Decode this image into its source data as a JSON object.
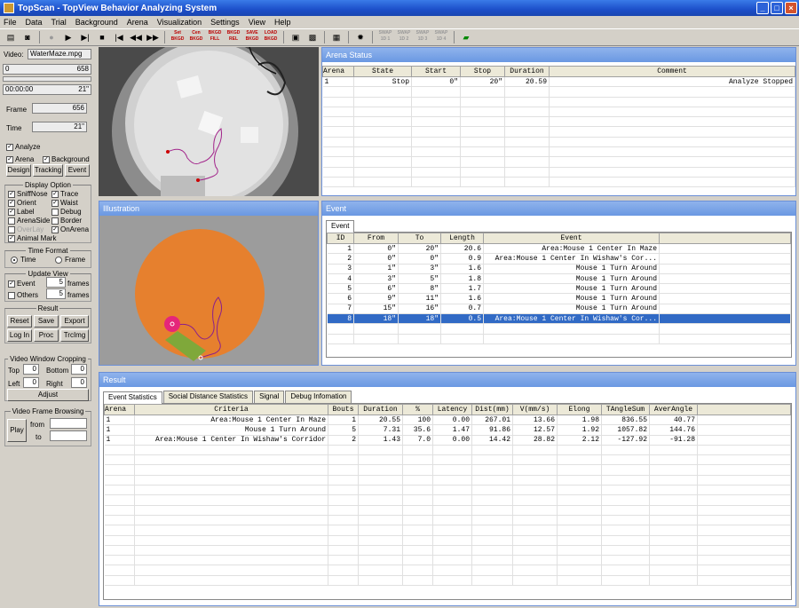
{
  "window": {
    "title": "TopScan - TopView Behavior Analyzing System"
  },
  "menu": [
    "File",
    "Data",
    "Trial",
    "Background",
    "Arena",
    "Visualization",
    "Settings",
    "View",
    "Help"
  ],
  "toolbar": {
    "icons": [
      "open-icon",
      "camera-icon",
      "record-icon",
      "play-icon",
      "step-forward-icon",
      "stop-icon",
      "step-back-icon",
      "rewind-icon",
      "fast-forward-icon"
    ],
    "labels": [
      "Set BKGD",
      "Cen BKGD",
      "BKGD FILL",
      "BKGD REL",
      "SAVE BKGD",
      "LOAD BKGD",
      "SWAP 1D 1",
      "SWAP 1D 2",
      "SWAP 1D 3",
      "SWAP 1D 4"
    ]
  },
  "left": {
    "video_label": "Video:",
    "video_file": "WaterMaze.mpg",
    "frame_min": "0",
    "frame_max": "658",
    "time_start": "00:00:00",
    "time_end": "21\"",
    "frame_label": "Frame",
    "frame_value": "656",
    "time_label": "Time",
    "time_value": "21\"",
    "analyze": "Analyze",
    "arena": "Arena",
    "background": "Background",
    "design_btn": "Design",
    "tracking_btn": "Tracking",
    "event_btn": "Event",
    "display_option": "Display Option",
    "opts": {
      "sniffnose": "SniffNose",
      "trace": "Trace",
      "orient": "Orient",
      "waist": "Waist",
      "label": "Label",
      "debug": "Debug",
      "arenaside": "ArenaSide",
      "border": "Border",
      "overlay": "OverLay",
      "onarena": "OnArena",
      "animalmark": "Animal Mark"
    },
    "time_format": "Time Format",
    "tf_time": "Time",
    "tf_frame": "Frame",
    "update_view": "Update View",
    "uv_event": "Event",
    "uv_event_n": "5",
    "uv_others": "Others",
    "uv_others_n": "5",
    "frames": "frames",
    "result": "Result",
    "reset_btn": "Reset",
    "save_btn": "Save",
    "export_btn": "Export",
    "login_btn": "Log In",
    "proc_btn": "Proc",
    "trcimg_btn": "TrcImg",
    "crop": "Video Window Cropping",
    "top": "Top",
    "top_v": "0",
    "bottom": "Bottom",
    "bottom_v": "0",
    "leftc": "Left",
    "left_v": "0",
    "right": "Right",
    "right_v": "0",
    "adjust_btn": "Adjust",
    "browse": "Video Frame Browsing",
    "play_btn": "Play",
    "from": "from",
    "to": "to"
  },
  "arena_status": {
    "title": "Arena Status",
    "headers": [
      "Arena",
      "State",
      "Start",
      "Stop",
      "Duration",
      "Comment"
    ],
    "rows": [
      [
        "1",
        "Stop",
        "0\"",
        "20\"",
        "20.59",
        "Analyze Stopped"
      ]
    ]
  },
  "illustration": {
    "title": "Illustration"
  },
  "event": {
    "title": "Event",
    "tab": "Event",
    "headers": [
      "ID",
      "From",
      "To",
      "Length",
      "Event"
    ],
    "rows": [
      [
        "1",
        "0\"",
        "20\"",
        "20.6",
        "Area:Mouse 1 Center In Maze"
      ],
      [
        "2",
        "0\"",
        "0\"",
        "0.9",
        "Area:Mouse 1 Center In Wishaw's Cor..."
      ],
      [
        "3",
        "1\"",
        "3\"",
        "1.6",
        "Mouse 1 Turn Around"
      ],
      [
        "4",
        "3\"",
        "5\"",
        "1.8",
        "Mouse 1 Turn Around"
      ],
      [
        "5",
        "6\"",
        "8\"",
        "1.7",
        "Mouse 1 Turn Around"
      ],
      [
        "6",
        "9\"",
        "11\"",
        "1.6",
        "Mouse 1 Turn Around"
      ],
      [
        "7",
        "15\"",
        "16\"",
        "0.7",
        "Mouse 1 Turn Around"
      ],
      [
        "8",
        "18\"",
        "18\"",
        "0.5",
        "Area:Mouse 1 Center In Wishaw's Cor..."
      ]
    ],
    "selected_row": 8
  },
  "result": {
    "title": "Result",
    "tabs": [
      "Event Statistics",
      "Social Distance Statistics",
      "Signal",
      "Debug Infomation"
    ],
    "headers": [
      "Arena",
      "Criteria",
      "Bouts",
      "Duration",
      "%",
      "Latency",
      "Dist(mm)",
      "V(mm/s)",
      "Elong",
      "TAngleSum",
      "AverAngle"
    ],
    "rows": [
      [
        "1",
        "Area:Mouse 1 Center In Maze",
        "1",
        "20.55",
        "100",
        "0.00",
        "267.01",
        "13.66",
        "1.98",
        "836.55",
        "40.77"
      ],
      [
        "1",
        "Mouse 1 Turn Around",
        "5",
        "7.31",
        "35.6",
        "1.47",
        "91.86",
        "12.57",
        "1.92",
        "1057.82",
        "144.76"
      ],
      [
        "1",
        "Area:Mouse 1 Center In Wishaw's Corridor",
        "2",
        "1.43",
        "7.0",
        "0.00",
        "14.42",
        "28.82",
        "2.12",
        "-127.92",
        "-91.28"
      ]
    ]
  },
  "colors": {
    "title_bar": "#1c4fc9",
    "panel_title": "#7aa2e6",
    "arena_fill": "#e6802e",
    "mouse_head": "#e5267a",
    "mouse_body": "#7fa83a",
    "selected": "#316ac5"
  }
}
